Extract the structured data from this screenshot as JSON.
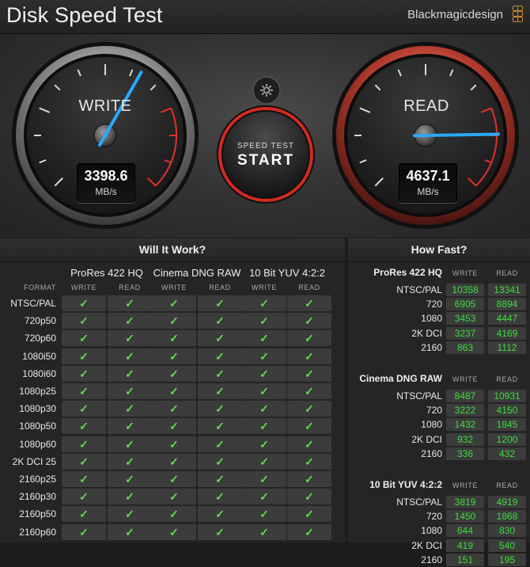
{
  "title": "Disk Speed Test",
  "brand": "Blackmagicdesign",
  "colors": {
    "accent_green": "#5ee04a",
    "needle_blue": "#2aa8ff",
    "red": "#e0322a"
  },
  "write_gauge": {
    "label": "WRITE",
    "value": "3398.6",
    "unit": "MB/s",
    "needle_fraction": 0.61
  },
  "read_gauge": {
    "label": "READ",
    "value": "4637.1",
    "unit": "MB/s",
    "needle_fraction": 0.83
  },
  "start_button": {
    "top_label": "SPEED TEST",
    "main_label": "START"
  },
  "settings_icon": "gear-icon",
  "will_it_work": {
    "title": "Will It Work?",
    "format_label": "FORMAT",
    "write_label": "WRITE",
    "read_label": "READ",
    "codecs": [
      "ProRes 422 HQ",
      "Cinema DNG RAW",
      "10 Bit YUV 4:2:2"
    ],
    "check_glyph": "✓",
    "formats": [
      "NTSC/PAL",
      "720p50",
      "720p60",
      "1080i50",
      "1080i60",
      "1080p25",
      "1080p30",
      "1080p50",
      "1080p60",
      "2K DCI 25",
      "2160p25",
      "2160p30",
      "2160p50",
      "2160p60"
    ]
  },
  "how_fast": {
    "title": "How Fast?",
    "write_label": "WRITE",
    "read_label": "READ",
    "groups": [
      {
        "name": "ProRes 422 HQ",
        "rows": [
          {
            "format": "NTSC/PAL",
            "write": "10358",
            "read": "13341"
          },
          {
            "format": "720",
            "write": "6905",
            "read": "8894"
          },
          {
            "format": "1080",
            "write": "3453",
            "read": "4447"
          },
          {
            "format": "2K DCI",
            "write": "3237",
            "read": "4169"
          },
          {
            "format": "2160",
            "write": "863",
            "read": "1112"
          }
        ]
      },
      {
        "name": "Cinema DNG RAW",
        "rows": [
          {
            "format": "NTSC/PAL",
            "write": "8487",
            "read": "10931"
          },
          {
            "format": "720",
            "write": "3222",
            "read": "4150"
          },
          {
            "format": "1080",
            "write": "1432",
            "read": "1845"
          },
          {
            "format": "2K DCI",
            "write": "932",
            "read": "1200"
          },
          {
            "format": "2160",
            "write": "336",
            "read": "432"
          }
        ]
      },
      {
        "name": "10 Bit YUV 4:2:2",
        "rows": [
          {
            "format": "NTSC/PAL",
            "write": "3819",
            "read": "4919"
          },
          {
            "format": "720",
            "write": "1450",
            "read": "1868"
          },
          {
            "format": "1080",
            "write": "644",
            "read": "830"
          },
          {
            "format": "2K DCI",
            "write": "419",
            "read": "540"
          },
          {
            "format": "2160",
            "write": "151",
            "read": "195"
          }
        ]
      }
    ]
  }
}
